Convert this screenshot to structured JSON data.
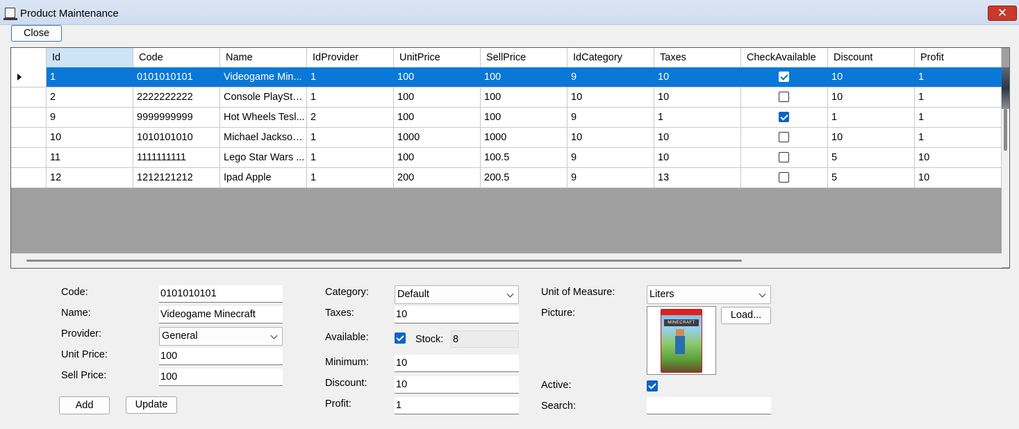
{
  "window": {
    "title": "Product Maintenance",
    "close_glyph": "✕",
    "icon": "app-icon"
  },
  "toolbar": {
    "close_label": "Close"
  },
  "grid": {
    "columns": [
      "Id",
      "Code",
      "Name",
      "IdProvider",
      "UnitPrice",
      "SellPrice",
      "IdCategory",
      "Taxes",
      "CheckAvailable",
      "Discount",
      "Profit"
    ],
    "rows": [
      {
        "id": "1",
        "code": "0101010101",
        "name": "Videogame Min...",
        "provider": "1",
        "unit": "100",
        "sell": "100",
        "category": "9",
        "taxes": "10",
        "available": true,
        "discount": "10",
        "profit": "1",
        "selected": true
      },
      {
        "id": "2",
        "code": "2222222222",
        "name": "Console PlaySta...",
        "provider": "1",
        "unit": "100",
        "sell": "100",
        "category": "10",
        "taxes": "10",
        "available": false,
        "discount": "10",
        "profit": "1"
      },
      {
        "id": "9",
        "code": "9999999999",
        "name": "Hot Wheels Tesl...",
        "provider": "2",
        "unit": "100",
        "sell": "100",
        "category": "9",
        "taxes": "1",
        "available": true,
        "discount": "1",
        "profit": "1"
      },
      {
        "id": "10",
        "code": "1010101010",
        "name": "Michael Jackson...",
        "provider": "1",
        "unit": "1000",
        "sell": "1000",
        "category": "10",
        "taxes": "10",
        "available": false,
        "discount": "10",
        "profit": "1"
      },
      {
        "id": "11",
        "code": "1111111111",
        "name": "Lego Star Wars ...",
        "provider": "1",
        "unit": "100",
        "sell": "100.5",
        "category": "9",
        "taxes": "10",
        "available": false,
        "discount": "5",
        "profit": "10"
      },
      {
        "id": "12",
        "code": "1212121212",
        "name": "Ipad Apple",
        "provider": "1",
        "unit": "200",
        "sell": "200.5",
        "category": "9",
        "taxes": "13",
        "available": false,
        "discount": "5",
        "profit": "10"
      }
    ]
  },
  "form": {
    "code_label": "Code:",
    "code_value": "0101010101",
    "name_label": "Name:",
    "name_value": "Videogame Minecraft",
    "provider_label": "Provider:",
    "provider_value": "General",
    "unit_price_label": "Unit Price:",
    "unit_price_value": "100",
    "sell_price_label": "Sell Price:",
    "sell_price_value": "100",
    "add_label": "Add",
    "update_label": "Update",
    "category_label": "Category:",
    "category_value": "Default",
    "taxes_label": "Taxes:",
    "taxes_value": "10",
    "available_label": "Available:",
    "available_checked": true,
    "stock_label": "Stock:",
    "stock_value": "8",
    "minimum_label": "Minimum:",
    "minimum_value": "10",
    "discount_label": "Discount:",
    "discount_value": "10",
    "profit_label": "Profit:",
    "profit_value": "1",
    "unit_label": "Unit of Measure:",
    "unit_value": "Liters",
    "picture_label": "Picture:",
    "load_label": "Load...",
    "picture_text": "MINECRAFT",
    "active_label": "Active:",
    "active_checked": true,
    "search_label": "Search:",
    "search_value": ""
  },
  "colors": {
    "selection": "#0a78d7",
    "header_selected": "#cde3f7",
    "grid_empty": "#a0a0a0"
  }
}
